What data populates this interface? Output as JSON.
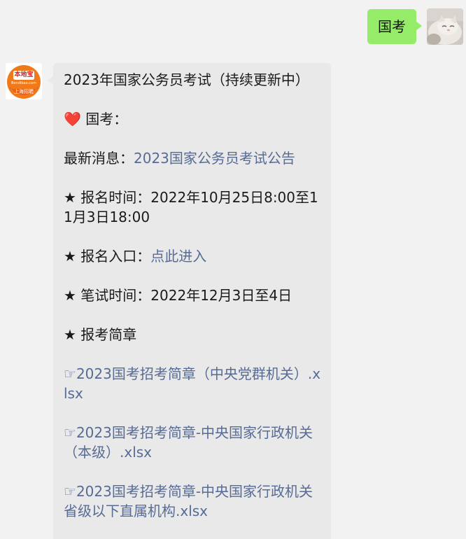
{
  "outgoing": {
    "text": "国考"
  },
  "incoming": {
    "avatar": {
      "name": "本地宝",
      "domain": "Bendibao.com",
      "city_label": "上海招聘"
    },
    "title": "2023年国家公务员考试（持续更新中）",
    "section_heart": "❤️",
    "section_label": "国考：",
    "latest_label": "最新消息：",
    "latest_link": "2023国家公务员考试公告",
    "bullet": "★",
    "reg_time_label": " 报名时间：",
    "reg_time_value": "2022年10月25日8:00至11月3日18:00",
    "reg_entry_label": " 报名入口：",
    "reg_entry_link": "点此进入",
    "exam_time_label": " 笔试时间：",
    "exam_time_value": "2022年12月3日至4日",
    "brochure_label": " 报考简章",
    "pointer": "☞",
    "files": [
      "2023国考招考简章（中央党群机关）.xlsx",
      "2023国考招考简章-中央国家行政机关（本级）.xlsx",
      "2023国考招考简章-中央国家行政机关省级以下直属机构.xlsx"
    ]
  }
}
